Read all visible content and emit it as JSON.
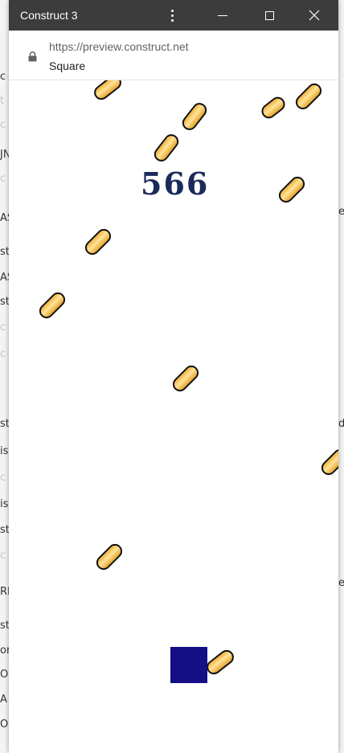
{
  "window": {
    "title": "Construct 3"
  },
  "address_bar": {
    "url": "https://preview.construct.net",
    "page_title": "Square"
  },
  "game": {
    "score": "566",
    "player_color": "#140f86",
    "bullet_color": "#f1b23a"
  },
  "background_fragments": {
    "left": [
      "t",
      "c",
      "c",
      "JN",
      "c",
      "AS",
      "st",
      "AS",
      "st",
      "c",
      "c",
      "st",
      "is",
      "c",
      "is",
      "st",
      "c",
      "RE",
      "st",
      "or",
      "O",
      "A",
      "O"
    ],
    "right": [
      "e",
      "d",
      "e"
    ]
  }
}
